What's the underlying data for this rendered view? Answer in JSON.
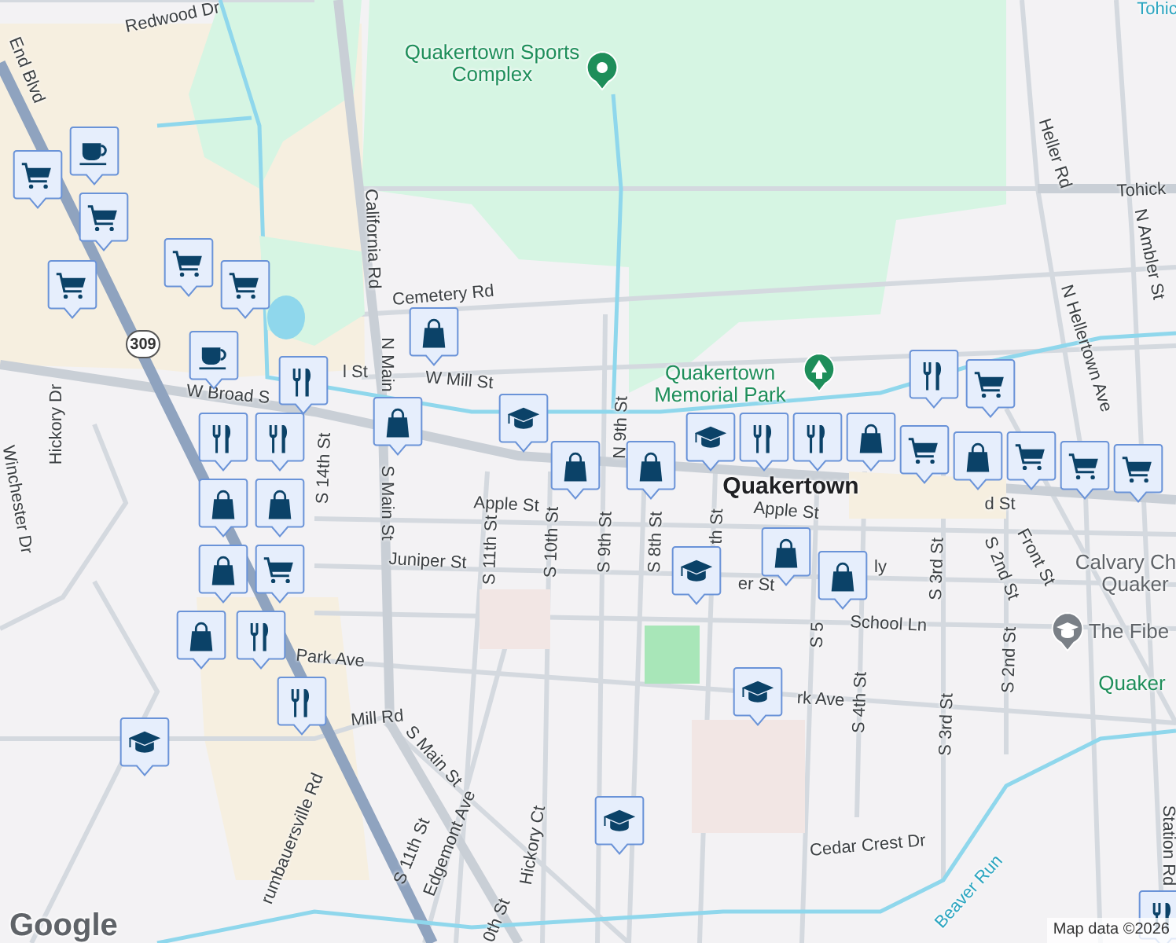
{
  "map": {
    "labels": [
      {
        "text": "Tohic",
        "kind": "water"
      },
      {
        "text": "Redwood Dr",
        "kind": "street"
      },
      {
        "text": "End Blvd",
        "kind": "street"
      },
      {
        "text": "Quakertown Sports Complex",
        "kind": "park"
      },
      {
        "text": "California Rd",
        "kind": "street"
      },
      {
        "text": "Heller Rd",
        "kind": "street"
      },
      {
        "text": "Tohick",
        "kind": "street"
      },
      {
        "text": "N Ambler St",
        "kind": "street"
      },
      {
        "text": "N Hellertown Ave",
        "kind": "street"
      },
      {
        "text": "Cemetery Rd",
        "kind": "street"
      },
      {
        "text": "l St",
        "kind": "street"
      },
      {
        "text": "W Mill St",
        "kind": "street"
      },
      {
        "text": "N Main",
        "kind": "street"
      },
      {
        "text": "W Broad S",
        "kind": "street"
      },
      {
        "text": "Quakertown Memorial Park",
        "kind": "park"
      },
      {
        "text": "N 9th St",
        "kind": "street"
      },
      {
        "text": "Hickory Dr",
        "kind": "street"
      },
      {
        "text": "Winchester Dr",
        "kind": "street"
      },
      {
        "text": "S 14th St",
        "kind": "street"
      },
      {
        "text": "S Main St",
        "kind": "street"
      },
      {
        "text": "Quakertown",
        "kind": "city"
      },
      {
        "text": "d St",
        "kind": "street"
      },
      {
        "text": "Apple St",
        "kind": "street"
      },
      {
        "text": "S 11th St",
        "kind": "street"
      },
      {
        "text": "S 10th St",
        "kind": "street"
      },
      {
        "text": "S 9th St",
        "kind": "street"
      },
      {
        "text": "S 8th St",
        "kind": "street"
      },
      {
        "text": "Apple St",
        "kind": "street"
      },
      {
        "text": "th St",
        "kind": "street"
      },
      {
        "text": "Calvary Ch",
        "kind": "place"
      },
      {
        "text": "Quaker",
        "kind": "place"
      },
      {
        "text": "S 3rd St",
        "kind": "street"
      },
      {
        "text": "S 2nd St",
        "kind": "street"
      },
      {
        "text": "Front St",
        "kind": "street"
      },
      {
        "text": "Juniper St",
        "kind": "street"
      },
      {
        "text": "er St",
        "kind": "street"
      },
      {
        "text": "ly",
        "kind": "street"
      },
      {
        "text": "S 5",
        "kind": "street"
      },
      {
        "text": "School Ln",
        "kind": "street"
      },
      {
        "text": "The Fibe",
        "kind": "place"
      },
      {
        "text": "S 2nd St",
        "kind": "street"
      },
      {
        "text": "Quaker",
        "kind": "park"
      },
      {
        "text": "Park Ave",
        "kind": "street"
      },
      {
        "text": "rk Ave",
        "kind": "street"
      },
      {
        "text": "S 4th St",
        "kind": "street"
      },
      {
        "text": "S 3rd St",
        "kind": "street"
      },
      {
        "text": "Mill Rd",
        "kind": "street"
      },
      {
        "text": "S Main St",
        "kind": "street"
      },
      {
        "text": "S 11th St",
        "kind": "street"
      },
      {
        "text": "Edgemont Ave",
        "kind": "street"
      },
      {
        "text": "Hickory Ct",
        "kind": "street"
      },
      {
        "text": "rumbauersville Rd",
        "kind": "street"
      },
      {
        "text": "0th St",
        "kind": "street"
      },
      {
        "text": "Cedar Crest Dr",
        "kind": "street"
      },
      {
        "text": "Beaver Run",
        "kind": "water"
      },
      {
        "text": "Station Rd",
        "kind": "street"
      }
    ],
    "route_shield": "309",
    "markers": [
      {
        "kind": "grocery"
      },
      {
        "kind": "cafe"
      },
      {
        "kind": "grocery"
      },
      {
        "kind": "grocery"
      },
      {
        "kind": "grocery"
      },
      {
        "kind": "grocery"
      },
      {
        "kind": "cafe"
      },
      {
        "kind": "shopping"
      },
      {
        "kind": "restaurant"
      },
      {
        "kind": "shopping"
      },
      {
        "kind": "school"
      },
      {
        "kind": "shopping"
      },
      {
        "kind": "shopping"
      },
      {
        "kind": "restaurant"
      },
      {
        "kind": "restaurant"
      },
      {
        "kind": "shopping"
      },
      {
        "kind": "shopping"
      },
      {
        "kind": "shopping"
      },
      {
        "kind": "grocery"
      },
      {
        "kind": "shopping"
      },
      {
        "kind": "restaurant"
      },
      {
        "kind": "restaurant"
      },
      {
        "kind": "school"
      },
      {
        "kind": "school"
      },
      {
        "kind": "shopping"
      },
      {
        "kind": "shopping"
      },
      {
        "kind": "school"
      },
      {
        "kind": "school"
      },
      {
        "kind": "restaurant"
      },
      {
        "kind": "school"
      },
      {
        "kind": "grocery"
      },
      {
        "kind": "restaurant"
      },
      {
        "kind": "restaurant"
      },
      {
        "kind": "grocery"
      },
      {
        "kind": "grocery"
      },
      {
        "kind": "shopping"
      },
      {
        "kind": "shopping"
      },
      {
        "kind": "grocery"
      },
      {
        "kind": "grocery"
      },
      {
        "kind": "restaurant"
      }
    ],
    "logo": "Google",
    "attribution": "Map data ©2026"
  }
}
